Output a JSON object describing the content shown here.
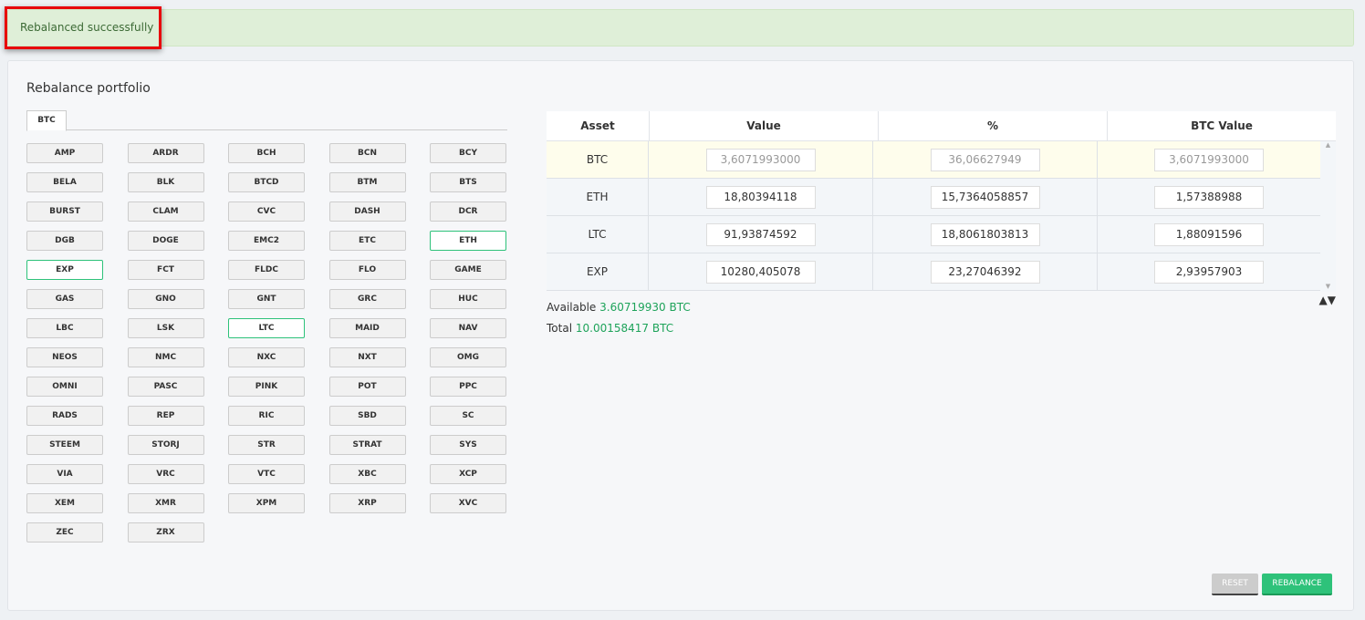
{
  "alert": {
    "message": "Rebalanced successfully"
  },
  "panel": {
    "title": "Rebalance portfolio",
    "tabs": [
      "BTC"
    ]
  },
  "coins": [
    {
      "label": "AMP",
      "selected": false
    },
    {
      "label": "ARDR",
      "selected": false
    },
    {
      "label": "BCH",
      "selected": false
    },
    {
      "label": "BCN",
      "selected": false
    },
    {
      "label": "BCY",
      "selected": false
    },
    {
      "label": "BELA",
      "selected": false
    },
    {
      "label": "BLK",
      "selected": false
    },
    {
      "label": "BTCD",
      "selected": false
    },
    {
      "label": "BTM",
      "selected": false
    },
    {
      "label": "BTS",
      "selected": false
    },
    {
      "label": "BURST",
      "selected": false
    },
    {
      "label": "CLAM",
      "selected": false
    },
    {
      "label": "CVC",
      "selected": false
    },
    {
      "label": "DASH",
      "selected": false
    },
    {
      "label": "DCR",
      "selected": false
    },
    {
      "label": "DGB",
      "selected": false
    },
    {
      "label": "DOGE",
      "selected": false
    },
    {
      "label": "EMC2",
      "selected": false
    },
    {
      "label": "ETC",
      "selected": false
    },
    {
      "label": "ETH",
      "selected": true
    },
    {
      "label": "EXP",
      "selected": true
    },
    {
      "label": "FCT",
      "selected": false
    },
    {
      "label": "FLDC",
      "selected": false
    },
    {
      "label": "FLO",
      "selected": false
    },
    {
      "label": "GAME",
      "selected": false
    },
    {
      "label": "GAS",
      "selected": false
    },
    {
      "label": "GNO",
      "selected": false
    },
    {
      "label": "GNT",
      "selected": false
    },
    {
      "label": "GRC",
      "selected": false
    },
    {
      "label": "HUC",
      "selected": false
    },
    {
      "label": "LBC",
      "selected": false
    },
    {
      "label": "LSK",
      "selected": false
    },
    {
      "label": "LTC",
      "selected": true
    },
    {
      "label": "MAID",
      "selected": false
    },
    {
      "label": "NAV",
      "selected": false
    },
    {
      "label": "NEOS",
      "selected": false
    },
    {
      "label": "NMC",
      "selected": false
    },
    {
      "label": "NXC",
      "selected": false
    },
    {
      "label": "NXT",
      "selected": false
    },
    {
      "label": "OMG",
      "selected": false
    },
    {
      "label": "OMNI",
      "selected": false
    },
    {
      "label": "PASC",
      "selected": false
    },
    {
      "label": "PINK",
      "selected": false
    },
    {
      "label": "POT",
      "selected": false
    },
    {
      "label": "PPC",
      "selected": false
    },
    {
      "label": "RADS",
      "selected": false
    },
    {
      "label": "REP",
      "selected": false
    },
    {
      "label": "RIC",
      "selected": false
    },
    {
      "label": "SBD",
      "selected": false
    },
    {
      "label": "SC",
      "selected": false
    },
    {
      "label": "STEEM",
      "selected": false
    },
    {
      "label": "STORJ",
      "selected": false
    },
    {
      "label": "STR",
      "selected": false
    },
    {
      "label": "STRAT",
      "selected": false
    },
    {
      "label": "SYS",
      "selected": false
    },
    {
      "label": "VIA",
      "selected": false
    },
    {
      "label": "VRC",
      "selected": false
    },
    {
      "label": "VTC",
      "selected": false
    },
    {
      "label": "XBC",
      "selected": false
    },
    {
      "label": "XCP",
      "selected": false
    },
    {
      "label": "XEM",
      "selected": false
    },
    {
      "label": "XMR",
      "selected": false
    },
    {
      "label": "XPM",
      "selected": false
    },
    {
      "label": "XRP",
      "selected": false
    },
    {
      "label": "XVC",
      "selected": false
    },
    {
      "label": "ZEC",
      "selected": false
    },
    {
      "label": "ZRX",
      "selected": false
    }
  ],
  "table": {
    "headers": [
      "Asset",
      "Value",
      "%",
      "BTC Value"
    ],
    "rows": [
      {
        "asset": "BTC",
        "value": "3,6071993000",
        "percent": "36,06627949",
        "btc_value": "3,6071993000",
        "readonly": true
      },
      {
        "asset": "ETH",
        "value": "18,80394118",
        "percent": "15,7364058857",
        "btc_value": "1,57388988",
        "readonly": false
      },
      {
        "asset": "LTC",
        "value": "91,93874592",
        "percent": "18,8061803813",
        "btc_value": "1,88091596",
        "readonly": false
      },
      {
        "asset": "EXP",
        "value": "10280,405078",
        "percent": "23,27046392",
        "btc_value": "2,93957903",
        "readonly": false
      }
    ]
  },
  "summary": {
    "available_label": "Available",
    "available_value": "3.60719930 BTC",
    "total_label": "Total",
    "total_value": "10.00158417 BTC"
  },
  "sort_icons": "▲▼",
  "buttons": {
    "reset": "RESET",
    "rebalance": "REBALANCE"
  }
}
